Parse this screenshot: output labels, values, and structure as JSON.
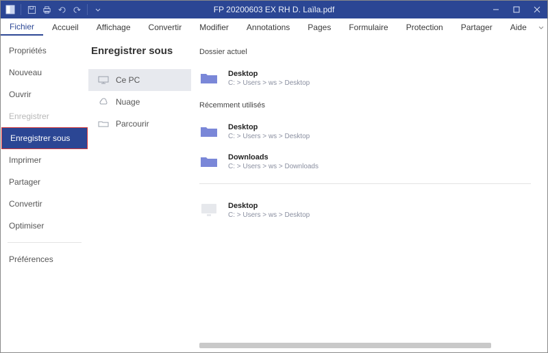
{
  "titlebar": {
    "title": "FP 20200603 EX RH D. Laïla.pdf"
  },
  "menubar": {
    "items": [
      {
        "label": "Fichier",
        "active": true
      },
      {
        "label": "Accueil"
      },
      {
        "label": "Affichage"
      },
      {
        "label": "Convertir"
      },
      {
        "label": "Modifier"
      },
      {
        "label": "Annotations"
      },
      {
        "label": "Pages"
      },
      {
        "label": "Formulaire"
      },
      {
        "label": "Protection"
      },
      {
        "label": "Partager"
      },
      {
        "label": "Aide"
      }
    ]
  },
  "sidebar": {
    "items": [
      {
        "label": "Propriétés"
      },
      {
        "label": "Nouveau"
      },
      {
        "label": "Ouvrir"
      },
      {
        "label": "Enregistrer",
        "disabled": true
      },
      {
        "label": "Enregistrer sous",
        "selected": true
      },
      {
        "label": "Imprimer"
      },
      {
        "label": "Partager"
      },
      {
        "label": "Convertir"
      },
      {
        "label": "Optimiser"
      }
    ],
    "preferences": "Préférences"
  },
  "col2": {
    "heading": "Enregistrer sous",
    "locations": [
      {
        "label": "Ce PC",
        "icon": "monitor",
        "selected": true
      },
      {
        "label": "Nuage",
        "icon": "cloud"
      },
      {
        "label": "Parcourir",
        "icon": "folder-outline"
      }
    ]
  },
  "col3": {
    "current_label": "Dossier actuel",
    "current": {
      "name": "Desktop",
      "path": "C: > Users > ws > Desktop"
    },
    "recent_label": "Récemment utilisés",
    "recent": [
      {
        "name": "Desktop",
        "path": "C: > Users > ws > Desktop"
      },
      {
        "name": "Downloads",
        "path": "C: > Users > ws > Downloads"
      }
    ],
    "other": {
      "name": "Desktop",
      "path": "C: > Users > ws > Desktop"
    }
  }
}
